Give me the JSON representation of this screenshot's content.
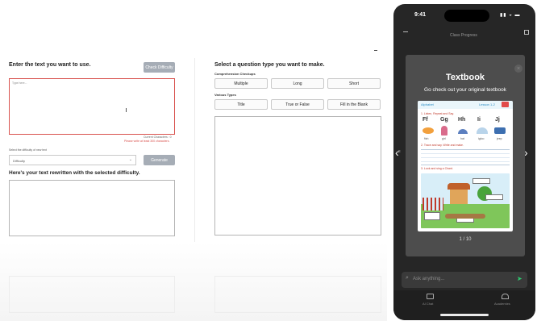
{
  "left_panel": {
    "heading": "Enter the text you want to use.",
    "check_button": "Check Difficulty",
    "text_placeholder": "Type here...",
    "current_chars": "Current Characters : 0",
    "min_chars_warning": "Please write at least 300 characters.",
    "difficulty_label": "Select the difficulty of new text",
    "difficulty_value": "Difficulty",
    "generate_button": "Generate",
    "rewritten_heading": "Here's your text rewritten with the selected difficulty."
  },
  "right_panel": {
    "heading": "Select a question type you want to make.",
    "comprehension_label": "Comprehension Checkups",
    "comprehension_buttons": [
      "Multiple",
      "Long",
      "Short"
    ],
    "various_label": "Various Types",
    "various_buttons": [
      "Title",
      "True or False",
      "Fill in the Blank"
    ]
  },
  "phone": {
    "status_time": "9:41",
    "nav_title": "Class Progress",
    "modal_title": "Textbook",
    "modal_subtitle": "Go check out your original textbook",
    "page_indicator": "1 / 10",
    "ask_placeholder": "Ask anything...",
    "tabs": [
      "AI Chat",
      "Academies"
    ],
    "textbook": {
      "header_left": "Alphabet",
      "header_right": "Lesson 1-2",
      "section1": "1. Listen, Repeat and Say.",
      "letters": [
        "Ff",
        "Gg",
        "Hh",
        "Ii",
        "Jj"
      ],
      "words": [
        "fish",
        "girl",
        "hat",
        "igloo",
        "jeep"
      ],
      "section2": "2. Trace and say. Write and make.",
      "section3": "3. Look and sing a Chant."
    },
    "accent": "#2ecc71"
  }
}
